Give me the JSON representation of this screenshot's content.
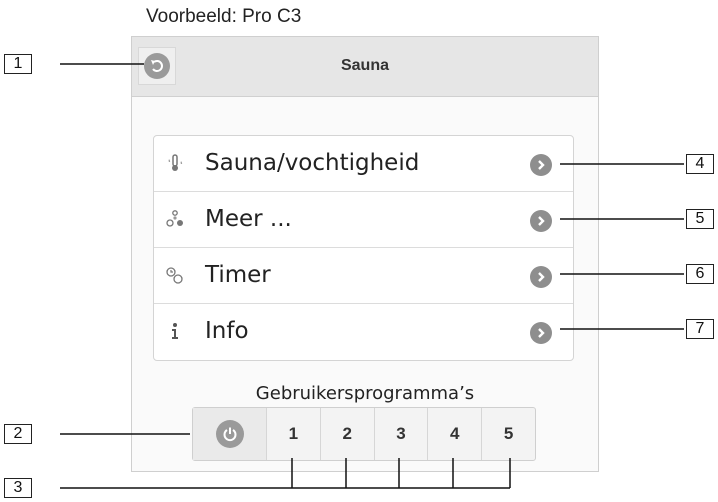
{
  "caption": "Voorbeeld: Pro C3",
  "header": {
    "title": "Sauna",
    "back_icon": "back-arrow-icon"
  },
  "menu": [
    {
      "label": "Sauna/vochtigheid",
      "icon": "thermometer-humidity-icon"
    },
    {
      "label": "Meer ...",
      "icon": "more-settings-icon"
    },
    {
      "label": "Timer",
      "icon": "timer-icon"
    },
    {
      "label": "Info",
      "icon": "info-icon"
    }
  ],
  "programs": {
    "title": "Gebruikersprogramma’s",
    "power_icon": "power-icon",
    "buttons": [
      "1",
      "2",
      "3",
      "4",
      "5"
    ]
  },
  "callouts": [
    "1",
    "2",
    "3",
    "4",
    "5",
    "6",
    "7"
  ],
  "colors": {
    "icon_gray": "#8e8e8e",
    "header_bg": "#e6e6e6"
  }
}
